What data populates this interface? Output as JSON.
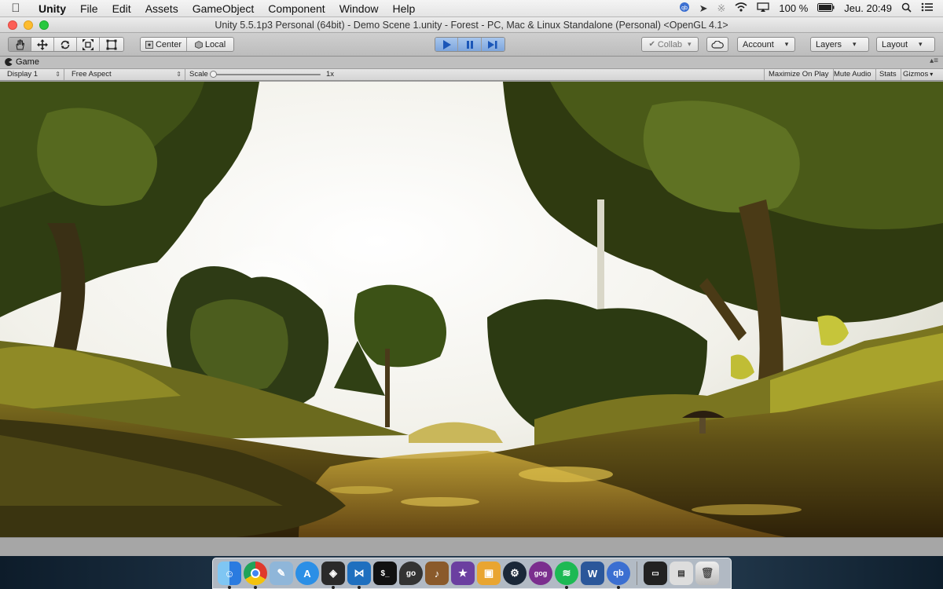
{
  "menubar": {
    "apple_icon": "apple-icon",
    "items": [
      "Unity",
      "File",
      "Edit",
      "Assets",
      "GameObject",
      "Component",
      "Window",
      "Help"
    ],
    "battery": "100 %",
    "clock": "Jeu. 20:49"
  },
  "window": {
    "title": "Unity 5.5.1p3 Personal (64bit) - Demo Scene 1.unity - Forest - PC, Mac & Linux Standalone (Personal) <OpenGL 4.1>"
  },
  "toolbar": {
    "transform_tools": [
      "hand-icon",
      "move-icon",
      "rotate-icon",
      "scale-icon",
      "rect-tool-icon"
    ],
    "pivot": "Center",
    "space": "Local",
    "collab": "Collab",
    "account": "Account",
    "layers": "Layers",
    "layout": "Layout",
    "play_color": "#1a56b8"
  },
  "game_tab": {
    "label": "Game"
  },
  "game_controls": {
    "display": "Display 1",
    "aspect": "Free Aspect",
    "scale_label": "Scale",
    "scale_value": "1x",
    "maximize": "Maximize On Play",
    "mute": "Mute Audio",
    "stats": "Stats",
    "gizmos": "Gizmos"
  },
  "dock": {
    "apps": [
      "Finder",
      "Chrome",
      "Preview",
      "App Store",
      "Unity",
      "Visual Studio Code",
      "Terminal",
      "GoPro",
      "Guitar",
      "iMovie",
      "Photos",
      "Steam",
      "GOG.com",
      "Spotify",
      "Word",
      "qBittorrent"
    ],
    "extras": [
      "Screenshot",
      "Downloads",
      "Trash"
    ]
  }
}
